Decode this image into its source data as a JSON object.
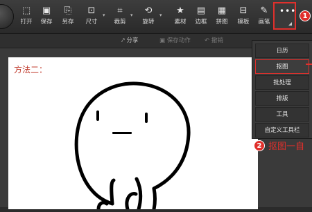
{
  "toolbar": {
    "tools": [
      {
        "id": "open",
        "label": "打开",
        "icon": "open-image-icon",
        "glyph": "⬚"
      },
      {
        "id": "save",
        "label": "保存",
        "icon": "save-icon",
        "glyph": "▣"
      },
      {
        "id": "save-as",
        "label": "另存",
        "icon": "save-as-icon",
        "glyph": "⎘"
      },
      {
        "id": "size",
        "label": "尺寸",
        "icon": "resize-icon",
        "glyph": "⊡"
      },
      {
        "id": "crop",
        "label": "裁剪",
        "icon": "crop-icon",
        "glyph": "⌗"
      },
      {
        "id": "rotate",
        "label": "旋转",
        "icon": "rotate-icon",
        "glyph": "⟲"
      },
      {
        "id": "material",
        "label": "素材",
        "icon": "star-icon",
        "glyph": "★"
      },
      {
        "id": "border",
        "label": "边框",
        "icon": "border-icon",
        "glyph": "▤"
      },
      {
        "id": "collage",
        "label": "拼图",
        "icon": "collage-icon",
        "glyph": "▦"
      },
      {
        "id": "template",
        "label": "模板",
        "icon": "template-icon",
        "glyph": "⊟"
      },
      {
        "id": "brush",
        "label": "画笔",
        "icon": "brush-icon",
        "glyph": "✎"
      }
    ],
    "more_glyph": "•••"
  },
  "subbar": {
    "share": "分享",
    "save_action": "保存动作",
    "undo": "撤销"
  },
  "canvas": {
    "method_label": "方法二："
  },
  "menu": {
    "items": [
      {
        "label": "日历",
        "highlight": false
      },
      {
        "label": "抠图",
        "highlight": true
      },
      {
        "label": "批处理",
        "highlight": false
      },
      {
        "label": "排版",
        "highlight": false
      },
      {
        "label": "工具",
        "highlight": false
      },
      {
        "label": "自定义工具栏",
        "highlight": false
      }
    ]
  },
  "annotations": {
    "badge1": "1",
    "badge2": "2",
    "step2_text": "抠图一自"
  },
  "colors": {
    "accent": "#e0302c",
    "toolbar_bg": "#2a2a2a"
  }
}
